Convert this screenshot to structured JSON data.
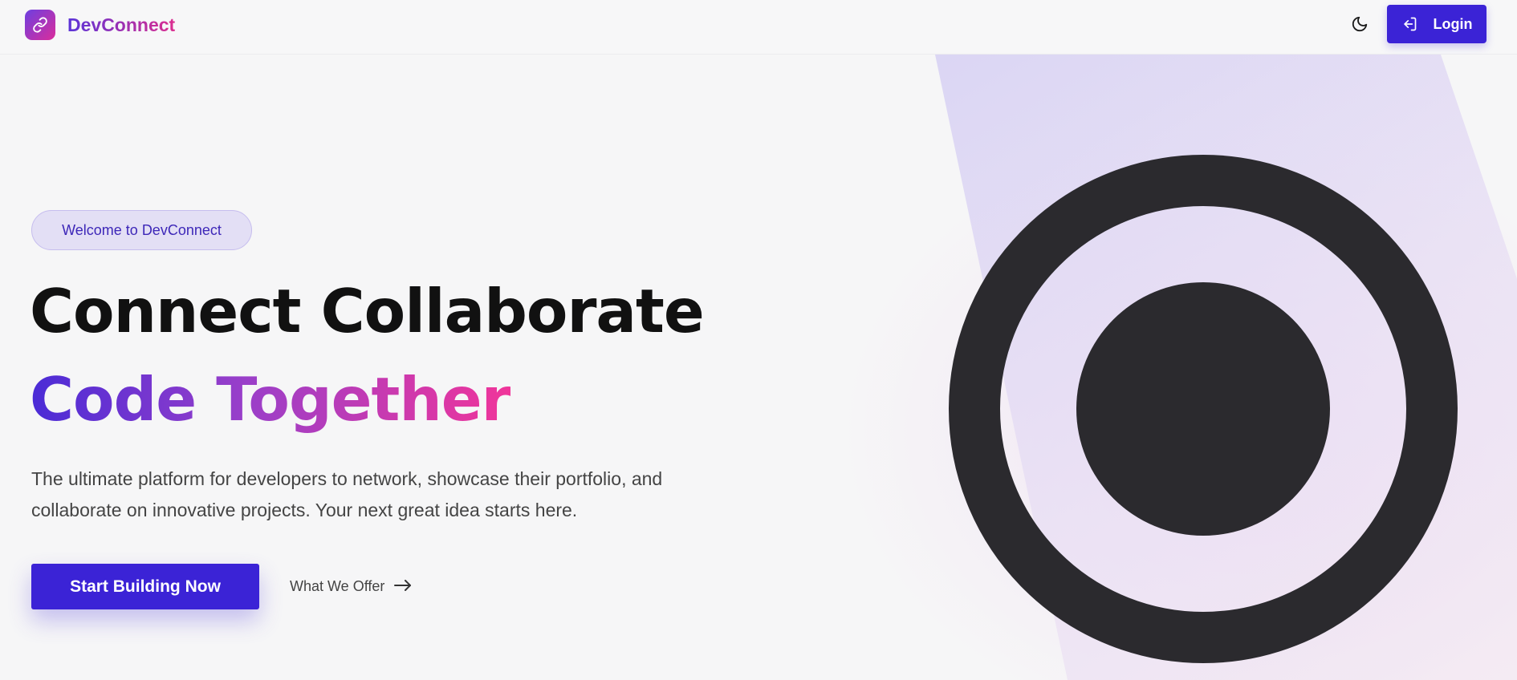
{
  "header": {
    "brand_name": "DevConnect",
    "logo_icon": "link-icon",
    "theme_icon": "moon-icon",
    "login_label": "Login",
    "login_icon": "login-icon"
  },
  "hero": {
    "badge": "Welcome to DevConnect",
    "headline_line1": "Connect Collaborate",
    "headline_line2": "Code Together",
    "description": "The ultimate platform for developers to network, showcase their portfolio, and collaborate on innovative projects. Your next great idea starts here.",
    "primary_cta": "Start Building Now",
    "secondary_cta": "What We Offer",
    "secondary_icon": "arrow-right-icon",
    "graphic_icon": "record-circle-icon"
  },
  "colors": {
    "accent": "#3b23d6",
    "gradient_start": "#4a2bd6",
    "gradient_end": "#f0359a",
    "graphic": "#2b2a2e"
  }
}
